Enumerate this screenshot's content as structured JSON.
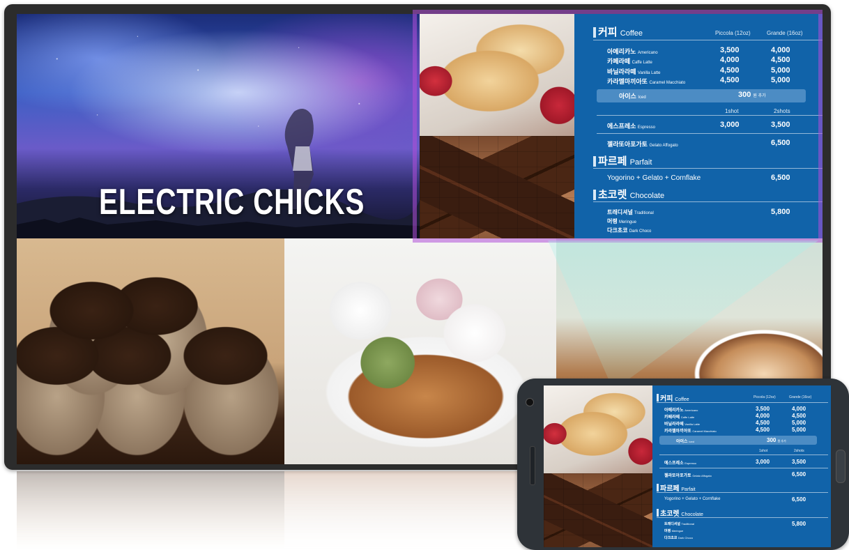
{
  "hero": {
    "title": "ELECTRIC CHICKS"
  },
  "menu": {
    "coffee": {
      "title": "커피",
      "title_en": "Coffee",
      "col1": "Piccola (12oz)",
      "col2": "Grande (16oz)",
      "items": [
        {
          "ko": "아메리카노",
          "en": "Americano",
          "p1": "3,500",
          "p2": "4,000"
        },
        {
          "ko": "카페라떼",
          "en": "Caffe Latte",
          "p1": "4,000",
          "p2": "4,500"
        },
        {
          "ko": "바닐라라떼",
          "en": "Vanilla Latte",
          "p1": "4,500",
          "p2": "5,000"
        },
        {
          "ko": "카라멜마끼아또",
          "en": "Caramel Macchiato",
          "p1": "4,500",
          "p2": "5,000"
        }
      ],
      "iced": {
        "ko": "아이스",
        "en": "Iced",
        "price": "300",
        "unit": "원 추가"
      },
      "shot_col1": "1shot",
      "shot_col2": "2shots",
      "espresso": {
        "ko": "에스프레소",
        "en": "Espresso",
        "p1": "3,000",
        "p2": "3,500"
      },
      "affogato": {
        "ko": "젤라또아포가토",
        "en": "Gelato Affogato",
        "price": "6,500"
      }
    },
    "parfait": {
      "title": "파르페",
      "title_en": "Parfait",
      "item": "Yogorino + Gelato + Cornflake",
      "price": "6,500"
    },
    "chocolate": {
      "title": "초코렛",
      "title_en": "Chocolate",
      "items": [
        {
          "ko": "트래디셔널",
          "en": "Traditional"
        },
        {
          "ko": "머랭",
          "en": "Meringue"
        },
        {
          "ko": "다크초코",
          "en": "Dark Choco"
        }
      ],
      "price": "5,800"
    }
  },
  "colors": {
    "menu_bg": "#1163a9",
    "iced_bar": "#4c8cc4",
    "bezel": "#2c2c2c",
    "phone_body": "#2e3338"
  }
}
